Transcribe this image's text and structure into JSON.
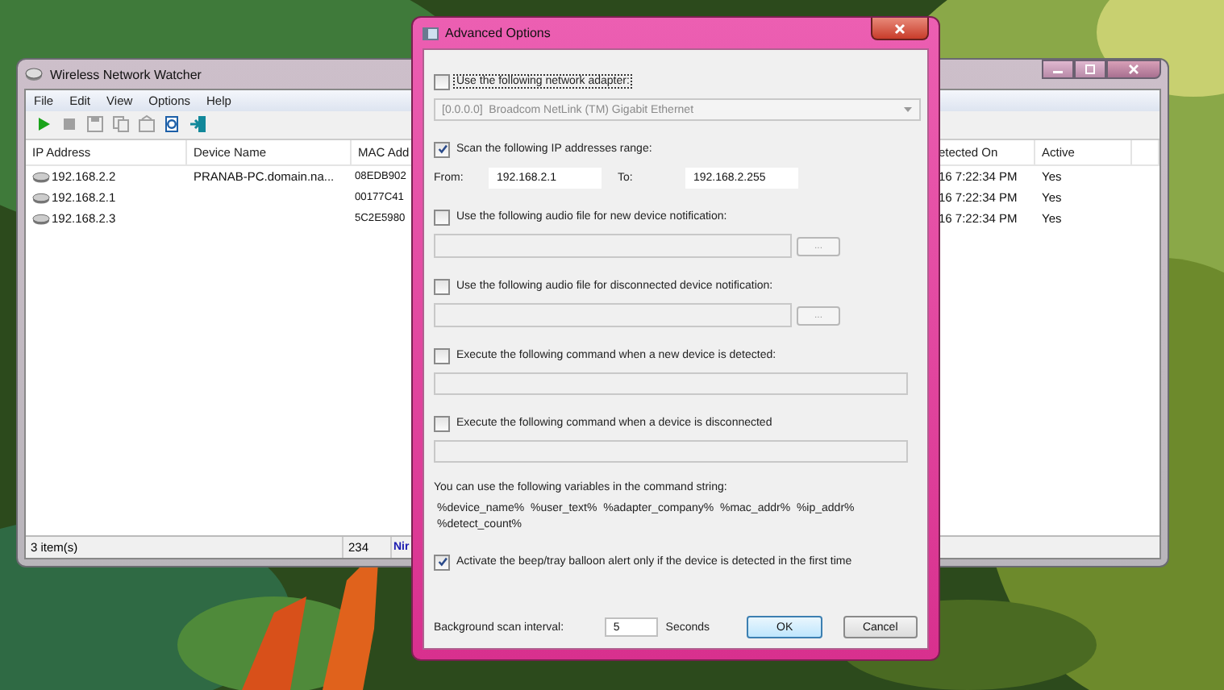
{
  "main_window": {
    "title": "Wireless Network Watcher",
    "menu": [
      "File",
      "Edit",
      "View",
      "Options",
      "Help"
    ],
    "toolbar": [
      {
        "kind": "play",
        "disabled": false
      },
      {
        "kind": "stop",
        "disabled": true
      },
      {
        "kind": "save",
        "disabled": true
      },
      {
        "kind": "copy",
        "disabled": true
      },
      {
        "kind": "properties",
        "disabled": true
      },
      {
        "kind": "report",
        "disabled": false
      },
      {
        "kind": "exit",
        "disabled": false
      }
    ],
    "columns": [
      "IP Address",
      "Device Name",
      "MAC Add",
      "etected On",
      "Active"
    ],
    "rows": [
      {
        "ip_address": "192.168.2.2",
        "device_name": "PRANAB-PC.domain.na...",
        "mac_address": "08EDB902",
        "detected_on": "16 7:22:34 PM",
        "active": "Yes"
      },
      {
        "ip_address": "192.168.2.1",
        "mac_address": "00177C41",
        "detected_on": "16 7:22:34 PM",
        "active": "Yes"
      },
      {
        "ip_address": "192.168.2.3",
        "mac_address": "5C2E5980",
        "detected_on": "16 7:22:34 PM",
        "active": "Yes"
      }
    ],
    "status_bar": {
      "items": "3 item(s)",
      "panel_2": "234",
      "link": "Nir"
    }
  },
  "dialog": {
    "title": "Advanced Options",
    "groups": [
      [
        {
          "kind": "checkbox",
          "label": "Use the following network adapter:",
          "checked": false,
          "focused": true
        },
        {
          "kind": "dropdown",
          "value": "[0.0.0.0]  Broadcom NetLink (TM) Gigabit Ethernet",
          "disabled": true
        }
      ],
      [
        {
          "kind": "checkbox",
          "label": "Scan the following IP addresses range:",
          "checked": true,
          "focused": false
        },
        {
          "kind": "range",
          "from_label": "From:",
          "from": "192.168.2.1",
          "to_label": "To:",
          "to": "192.168.2.255"
        }
      ],
      [
        {
          "kind": "checkbox",
          "label": "Use the following audio file for new device notification:",
          "checked": false,
          "focused": false
        },
        {
          "kind": "file",
          "browse": "...",
          "disabled": true
        }
      ],
      [
        {
          "kind": "checkbox",
          "label": "Use the following audio file for disconnected device notification:",
          "checked": false,
          "focused": false
        },
        {
          "kind": "file",
          "browse": "...",
          "disabled": true
        }
      ],
      [
        {
          "kind": "checkbox",
          "label": "Execute the following command when a new device is detected:",
          "checked": false,
          "focused": false
        },
        {
          "kind": "command",
          "disabled": true
        }
      ],
      [
        {
          "kind": "checkbox",
          "label": "Execute the following command when a device is disconnected",
          "checked": false,
          "focused": false
        },
        {
          "kind": "command",
          "disabled": true
        }
      ],
      [
        {
          "kind": "note",
          "text": "You can use the following variables in the command string:"
        },
        {
          "kind": "variables",
          "text": "%device_name%  %user_text%  %adapter_company%  %mac_addr%  %ip_addr%  %detect_count%"
        }
      ],
      [
        {
          "kind": "checkbox",
          "label": "Activate the beep/tray balloon alert only if the device is detected in the first time",
          "checked": true,
          "focused": false
        }
      ]
    ],
    "interval": {
      "label": "Background scan interval:",
      "value": "5",
      "unit": "Seconds"
    },
    "buttons": [
      {
        "label": "OK",
        "default": true
      },
      {
        "label": "Cancel",
        "default": false
      }
    ]
  }
}
